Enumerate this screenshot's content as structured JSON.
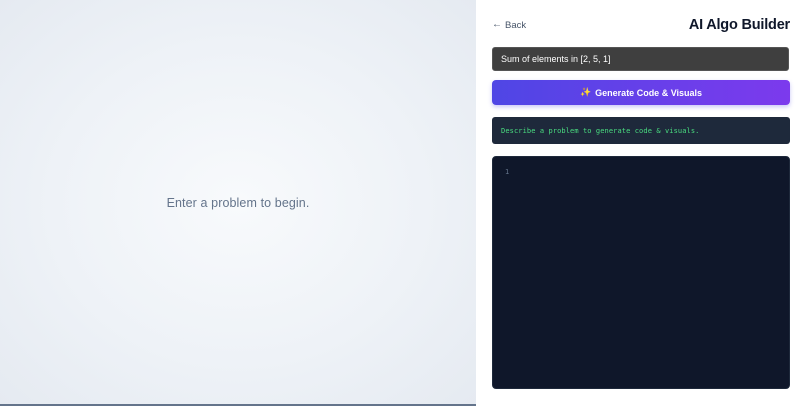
{
  "left_panel": {
    "empty_message": "Enter a problem to begin."
  },
  "header": {
    "back_arrow": "←",
    "back_label": "Back",
    "title": "AI Algo Builder"
  },
  "problem_input": {
    "value": "Sum of elements in [2, 5, 1]",
    "placeholder": ""
  },
  "generate_button": {
    "icon": "✨",
    "label": "Generate Code & Visuals"
  },
  "status": {
    "text": "Describe a problem to generate code & visuals."
  },
  "code_editor": {
    "line_numbers": [
      "1"
    ]
  },
  "colors": {
    "accent_start": "#4f46e5",
    "accent_end": "#7c3aed",
    "status_text": "#4ade80",
    "editor_bg": "#0f172a"
  }
}
